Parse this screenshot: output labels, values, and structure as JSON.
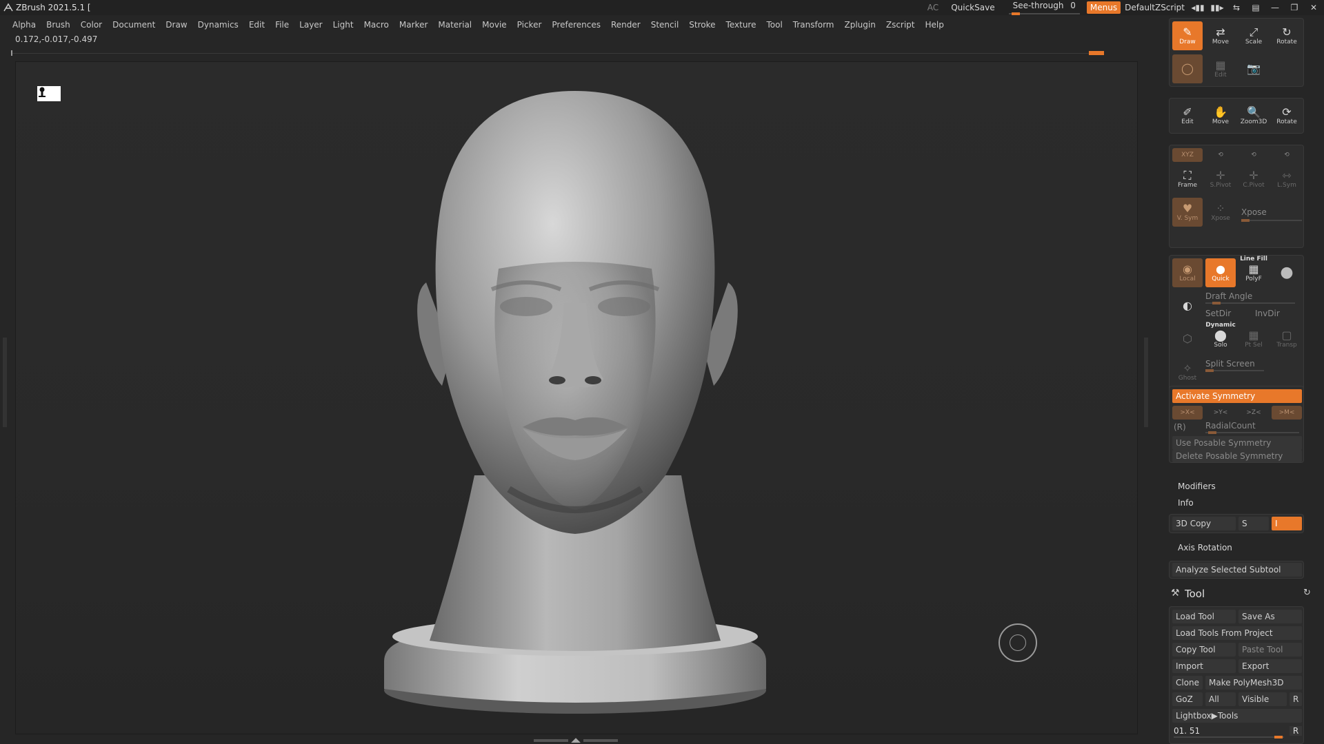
{
  "titlebar": {
    "app_title": "ZBrush 2021.5.1 [",
    "ac": "AC",
    "quicksave": "QuickSave",
    "see_through_label": "See-through",
    "see_through_value": "0",
    "menus": "Menus",
    "default_zscript": "DefaultZScript",
    "colors": {
      "accent": "#e8782a",
      "bg": "#222222"
    }
  },
  "menubar": {
    "items": [
      "Alpha",
      "Brush",
      "Color",
      "Document",
      "Draw",
      "Dynamics",
      "Edit",
      "File",
      "Layer",
      "Light",
      "Macro",
      "Marker",
      "Material",
      "Movie",
      "Picker",
      "Preferences",
      "Render",
      "Stencil",
      "Stroke",
      "Texture",
      "Tool",
      "Transform",
      "Zplugin",
      "Zscript",
      "Help"
    ]
  },
  "coords": "0.172,-0.017,-0.497",
  "panel": {
    "draw_group": {
      "draw": "Draw",
      "move": "Move",
      "scale": "Scale",
      "rotate": "Rotate",
      "edit": "Edit"
    },
    "view_group": {
      "edit": "Edit",
      "move": "Move",
      "zoom3d": "Zoom3D",
      "rotate": "Rotate"
    },
    "pivot_group": {
      "xyz": "XYZ",
      "frame": "Frame",
      "spivot": "S.Pivot",
      "cpivot": "C.Pivot",
      "lsym": "L.Sym",
      "vsym": "V. Sym",
      "xpose_btn": "Xpose",
      "xpose_label": "Xpose"
    },
    "render_group": {
      "local": "Local",
      "quick": "Quick",
      "line_fill": "Line Fill",
      "polyf": "PolyF",
      "draft_angle": "Draft Angle",
      "setdir": "SetDir",
      "invdir": "InvDir",
      "dynamic": "Dynamic",
      "solo": "Solo",
      "ptsel": "Pt Sel",
      "transp": "Transp",
      "ghost": "Ghost",
      "split_screen": "Split Screen"
    },
    "symmetry": {
      "activate": "Activate Symmetry",
      "x": ">X<",
      "y": ">Y<",
      "z": ">Z<",
      "m": ">M<",
      "r": "(R)",
      "radial": "RadialCount",
      "use_posable": "Use Posable Symmetry",
      "delete_posable": "Delete Posable Symmetry"
    },
    "modifiers": "Modifiers",
    "info": "Info",
    "copy3d": "3D Copy",
    "copy3d_s": "S",
    "copy3d_i": "I",
    "axis_rotation": "Axis Rotation",
    "analyze": "Analyze Selected Subtool",
    "tool": {
      "title": "Tool",
      "load_tool": "Load Tool",
      "save_as": "Save As",
      "load_from_project": "Load Tools From Project",
      "copy_tool": "Copy Tool",
      "paste_tool": "Paste Tool",
      "import": "Import",
      "export": "Export",
      "clone": "Clone",
      "make_polymesh": "Make PolyMesh3D",
      "goz": "GoZ",
      "all": "All",
      "visible": "Visible",
      "r": "R",
      "lightbox_tools": "Lightbox▶Tools",
      "slider_value": "01. 51",
      "slider_r": "R"
    }
  }
}
